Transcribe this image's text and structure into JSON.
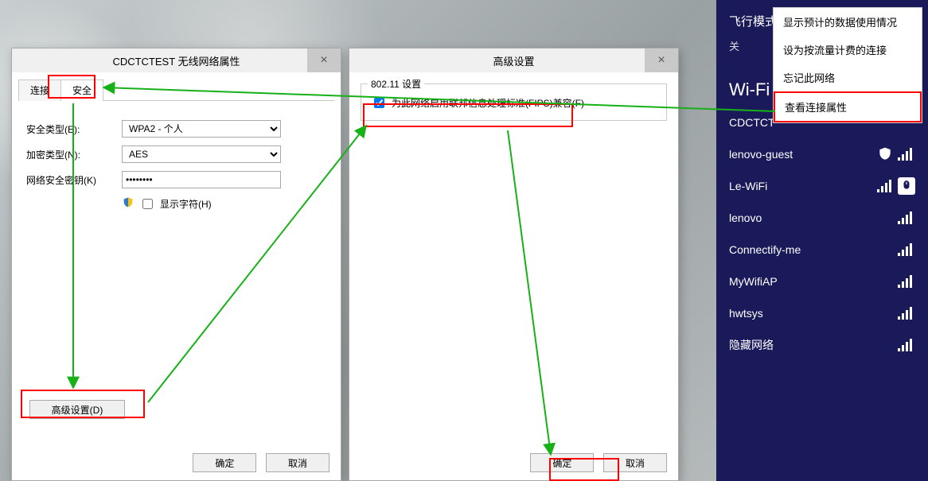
{
  "dialog_props": {
    "title": "CDCTCTEST 无线网络属性",
    "tabs": {
      "connect": "连接",
      "security": "安全"
    },
    "labels": {
      "security_type": "安全类型(E):",
      "encryption": "加密类型(N):",
      "key": "网络安全密钥(K)",
      "show_chars": "显示字符(H)",
      "advanced": "高级设置(D)"
    },
    "values": {
      "security_type": "WPA2 - 个人",
      "encryption": "AES",
      "key": "●●●●●●●●"
    },
    "buttons": {
      "ok": "确定",
      "cancel": "取消"
    }
  },
  "dialog_adv": {
    "title": "高级设置",
    "group_title": "802.11 设置",
    "fips_label": "为此网络启用联邦信息处理标准(FIPS)兼容(F)",
    "buttons": {
      "ok": "确定",
      "cancel": "取消"
    }
  },
  "charms": {
    "airplane": "飞行模式",
    "airplane_state": "关",
    "wifi_title": "Wi-Fi",
    "networks": [
      {
        "name": "CDCTCT"
      },
      {
        "name": "lenovo-guest",
        "shield": true
      },
      {
        "name": "Le-WiFi",
        "mouse": true
      },
      {
        "name": "lenovo"
      },
      {
        "name": "Connectify-me"
      },
      {
        "name": "MyWifiAP"
      },
      {
        "name": "hwtsys"
      },
      {
        "name": "隐藏网络"
      }
    ],
    "menu": {
      "usage": "显示预计的数据使用情况",
      "metered": "设为按流量计费的连接",
      "forget": "忘记此网络",
      "view_props": "查看连接属性"
    }
  }
}
